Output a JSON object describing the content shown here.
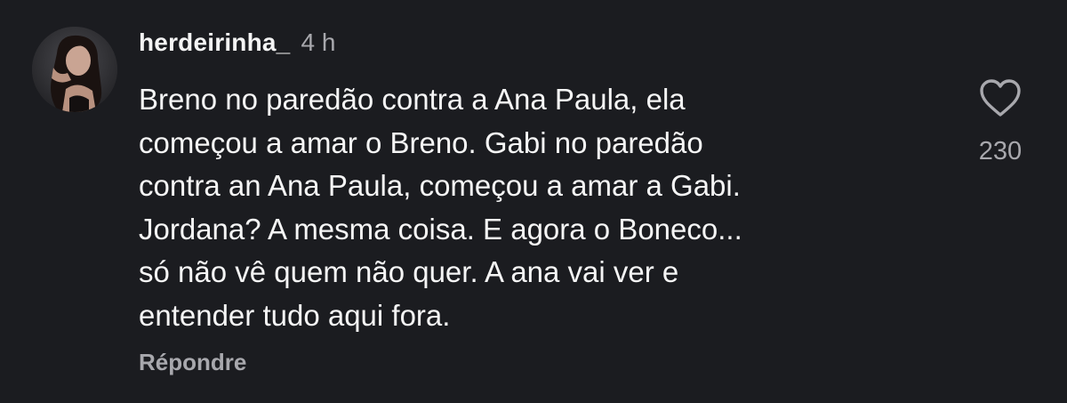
{
  "comment": {
    "username": "herdeirinha_",
    "timestamp": "4 h",
    "lines": [
      "Breno no paredão contra a Ana Paula, ela",
      "começou a amar o Breno. Gabi no paredão",
      "contra an Ana Paula, começou a amar a Gabi.",
      "Jordana? A mesma coisa. E agora o Boneco...",
      "só não vê quem não quer. A ana vai ver e",
      "entender tudo aqui fora."
    ],
    "reply_label": "Répondre",
    "like_count": "230",
    "like_icon": "heart-outline-icon"
  },
  "colors": {
    "background": "#1b1c20",
    "text": "#f5f5f5",
    "secondary_text": "#a8a8ad"
  }
}
